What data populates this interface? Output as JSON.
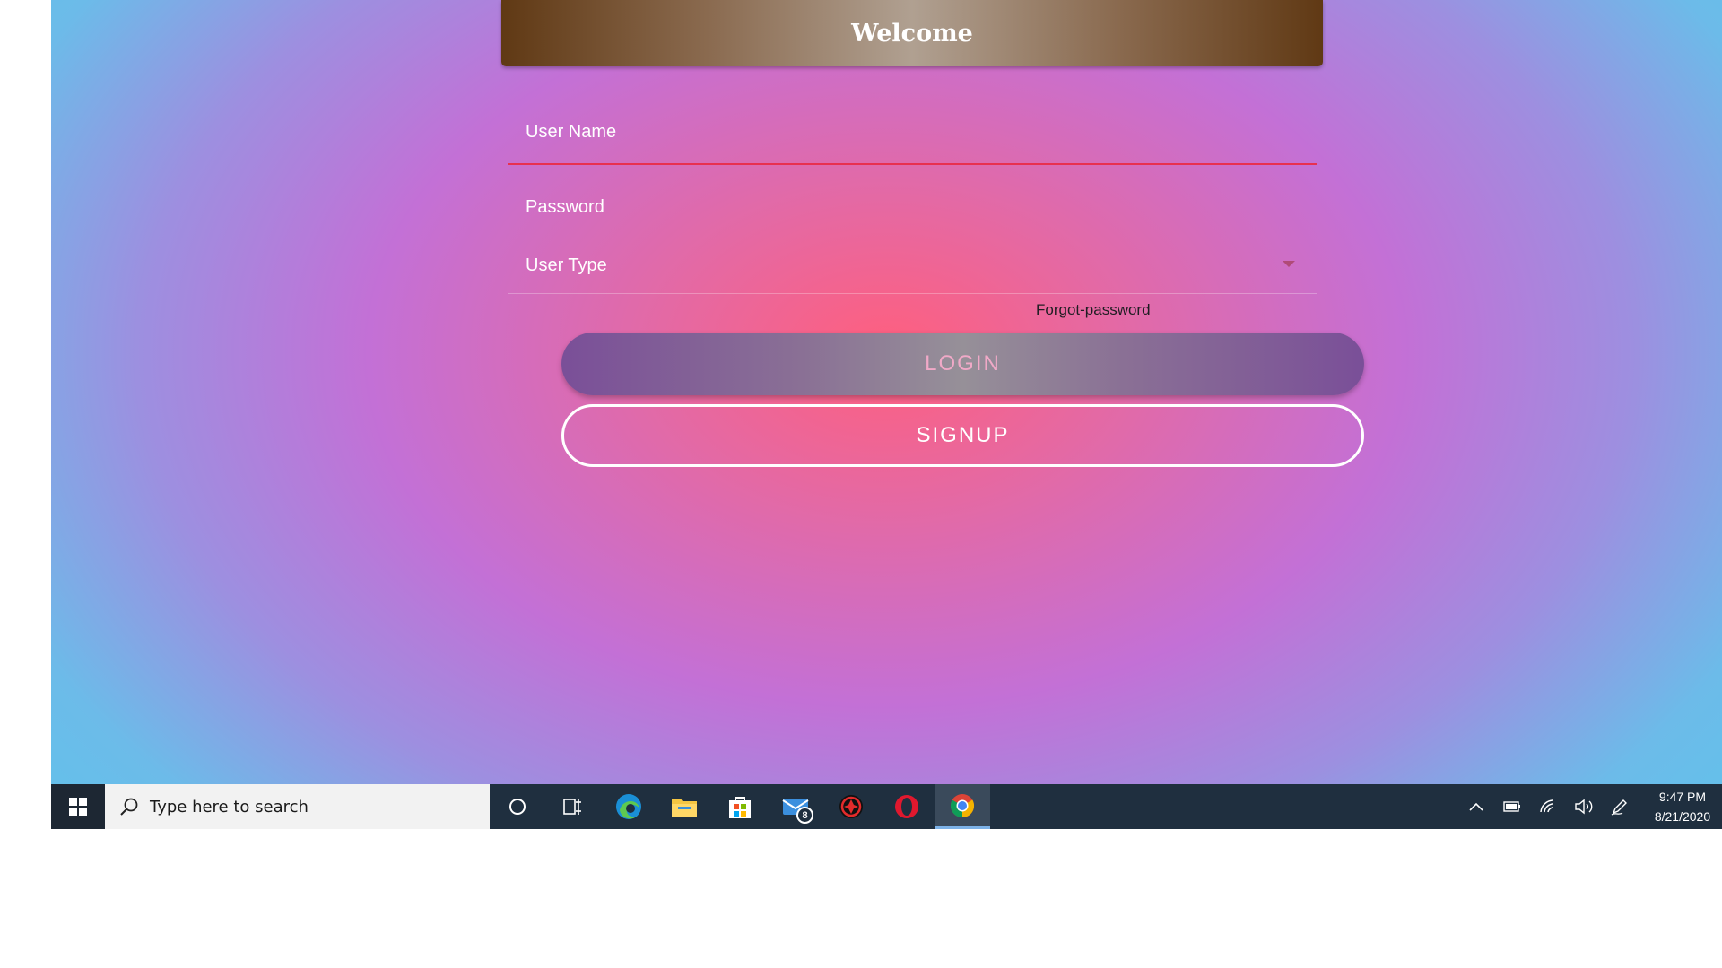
{
  "header": {
    "title": "Welcome"
  },
  "form": {
    "username_placeholder": "User Name",
    "username_value": "",
    "password_placeholder": "Password",
    "password_value": "",
    "usertype_label": "User Type",
    "forgot_label": "Forgot-password",
    "login_label": "LOGIN",
    "signup_label": "SIGNUP"
  },
  "taskbar": {
    "search_placeholder": "Type here to search",
    "apps": [
      "start-icon",
      "cortana-icon",
      "task-view-icon",
      "edge-icon",
      "file-explorer-icon",
      "store-icon",
      "mail-icon",
      "security-app-icon",
      "opera-icon",
      "chrome-icon"
    ],
    "mail_badge": "8",
    "time": "9:47 PM",
    "date": "8/21/2020"
  },
  "colors": {
    "accent_underline": "#e8304f",
    "taskbar_bg": "#1f2f3f",
    "welcome_gradient_edge": "#603914"
  }
}
